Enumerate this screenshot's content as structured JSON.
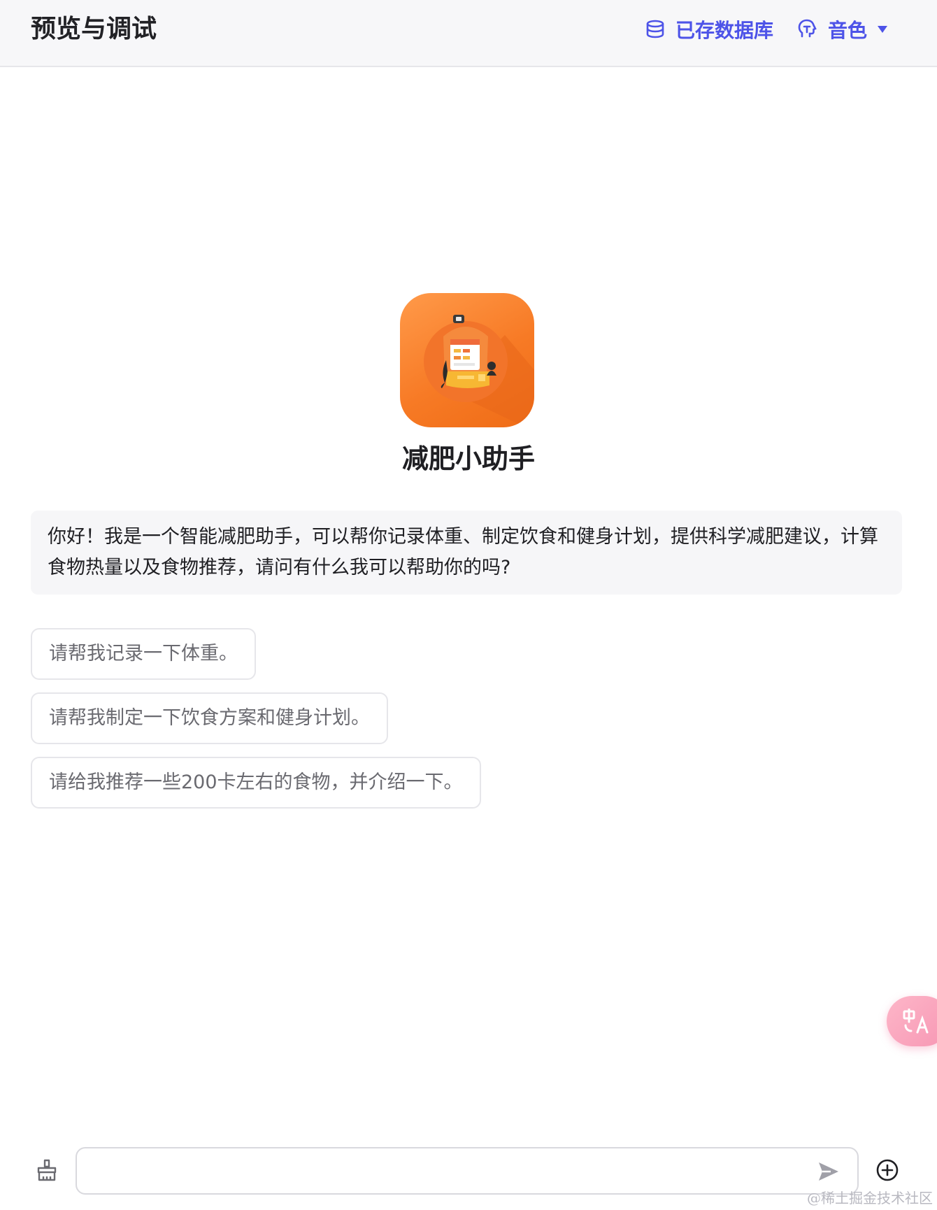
{
  "header": {
    "title": "预览与调试",
    "database_label": "已存数据库",
    "voice_label": "音色"
  },
  "bot": {
    "name": "减肥小助手",
    "avatar_icon": "robot-cashier-avatar",
    "avatar_color": "#f7822c"
  },
  "welcome_message": "你好！我是一个智能减肥助手，可以帮你记录体重、制定饮食和健身计划，提供科学减肥建议，计算食物热量以及食物推荐，请问有什么我可以帮助你的吗?",
  "suggestions": [
    "请帮我记录一下体重。",
    "请帮我制定一下饮食方案和健身计划。",
    "请给我推荐一些200卡左右的食物，并介绍一下。"
  ],
  "composer": {
    "input_value": "",
    "placeholder": ""
  },
  "floating": {
    "translate_icon": "translate-icon",
    "color": "#f797b4"
  },
  "watermark": "@稀土掘金技术社区",
  "colors": {
    "accent": "#4d53e8",
    "header_bg": "#f7f7f9"
  }
}
